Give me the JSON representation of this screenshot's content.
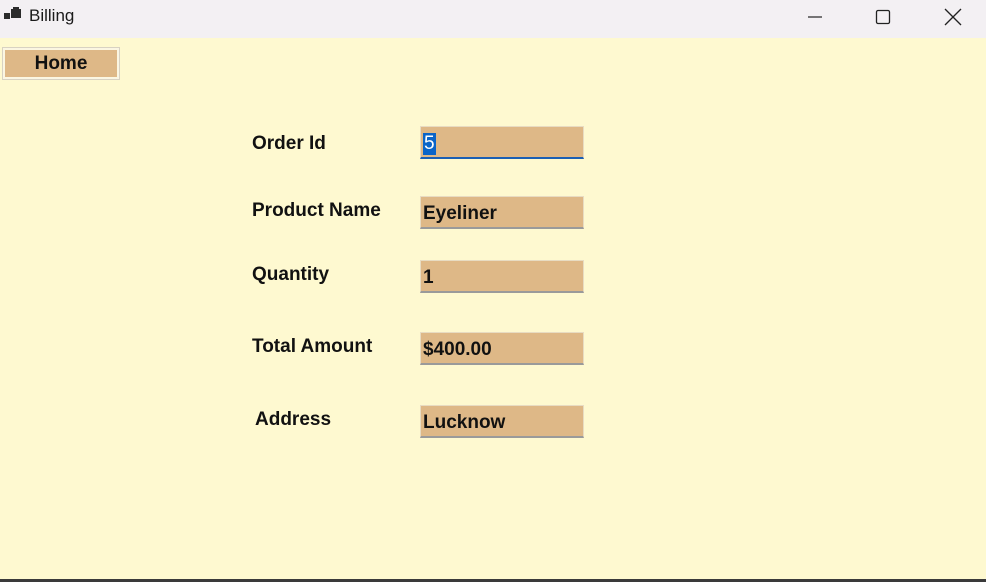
{
  "window": {
    "title": "Billing",
    "icon": "app-window-icon"
  },
  "nav": {
    "home_label": "Home"
  },
  "form": {
    "order_id": {
      "label": "Order Id",
      "value": "5"
    },
    "product_name": {
      "label": "Product Name",
      "value": "Eyeliner"
    },
    "quantity": {
      "label": "Quantity",
      "value": "1"
    },
    "total_amount": {
      "label": "Total Amount",
      "value": "$400.00"
    },
    "address": {
      "label": "Address",
      "value": "Lucknow"
    }
  },
  "colors": {
    "background": "#fef9d0",
    "field_fill": "#deb887",
    "selection": "#0a64c8"
  }
}
